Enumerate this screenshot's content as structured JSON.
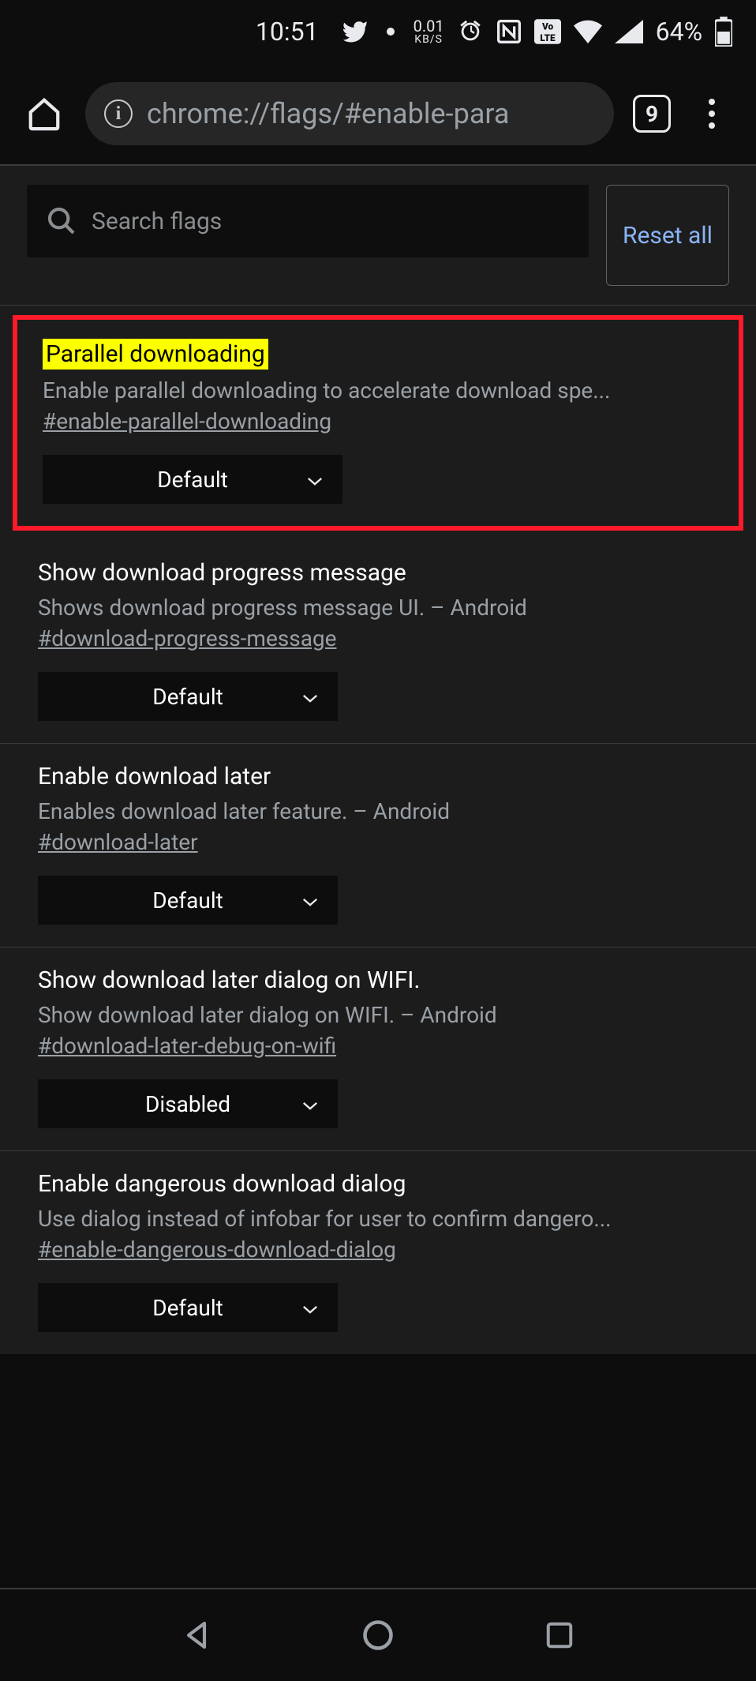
{
  "status_bar": {
    "time": "10:51",
    "kbs_value": "0.01",
    "kbs_label": "KB/S",
    "battery_pct": "64%"
  },
  "browser": {
    "url": "chrome://flags/#enable-para",
    "tab_count": "9"
  },
  "search": {
    "placeholder": "Search flags",
    "reset_label": "Reset all"
  },
  "flags": [
    {
      "title": "Parallel downloading",
      "desc": "Enable parallel downloading to accelerate download spe...",
      "anchor": "#enable-parallel-downloading",
      "value": "Default",
      "highlighted": true
    },
    {
      "title": "Show download progress message",
      "desc": "Shows download progress message UI. – Android",
      "anchor": "#download-progress-message",
      "value": "Default",
      "highlighted": false
    },
    {
      "title": "Enable download later",
      "desc": "Enables download later feature. – Android",
      "anchor": "#download-later",
      "value": "Default",
      "highlighted": false
    },
    {
      "title": "Show download later dialog on WIFI.",
      "desc": "Show download later dialog on WIFI. – Android",
      "anchor": "#download-later-debug-on-wifi",
      "value": "Disabled",
      "highlighted": false
    },
    {
      "title": "Enable dangerous download dialog",
      "desc": "Use dialog instead of infobar for user to confirm dangero...",
      "anchor": "#enable-dangerous-download-dialog",
      "value": "Default",
      "highlighted": false
    }
  ]
}
